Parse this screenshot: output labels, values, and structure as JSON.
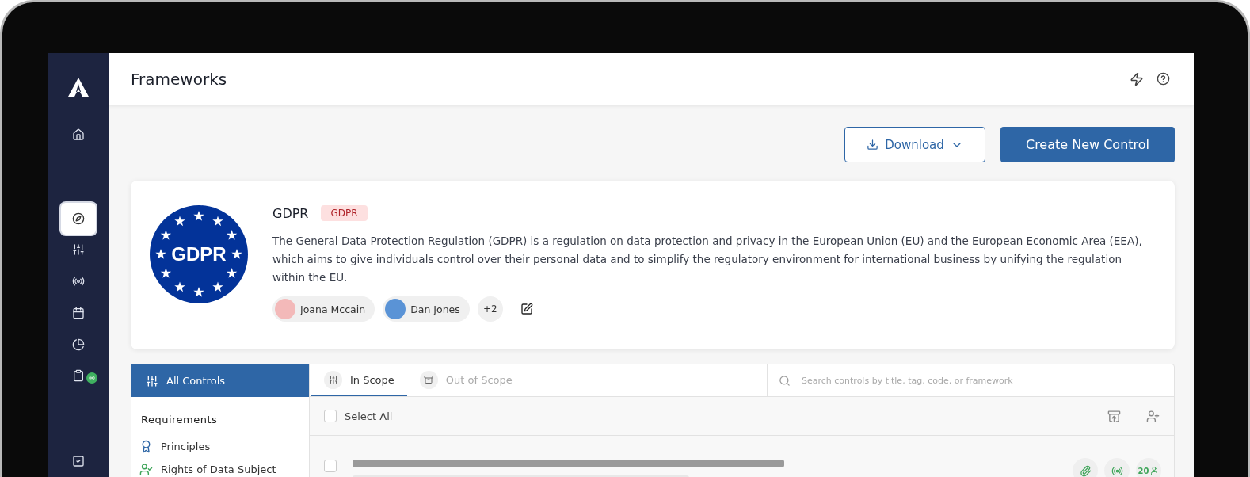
{
  "sidebar": {
    "items": [
      {
        "kind": "home",
        "selected": false,
        "badge": false
      },
      {
        "kind": "compass",
        "selected": true,
        "badge": false
      },
      {
        "kind": "sliders",
        "selected": false,
        "badge": false
      },
      {
        "kind": "radio",
        "selected": false,
        "badge": false
      },
      {
        "kind": "calendar",
        "selected": false,
        "badge": false
      },
      {
        "kind": "pie",
        "selected": false,
        "badge": false
      },
      {
        "kind": "clipboard",
        "selected": false,
        "badge": true
      },
      {
        "kind": "checklist",
        "selected": false,
        "badge": false
      }
    ]
  },
  "header": {
    "title": "Frameworks"
  },
  "actions": {
    "download": "Download",
    "create": "Create New Control"
  },
  "framework": {
    "logo_text": "GDPR",
    "name": "GDPR",
    "tag": "GDPR",
    "description": "The General Data Protection Regulation (GDPR) is a regulation on data protection and privacy in the European Union (EU) and the European Economic Area (EEA), which aims to give individuals control over their personal data and to simplify the regulatory environment for international business by unifying the regulation within the EU.",
    "owners": [
      {
        "name": "Joana Mccain"
      },
      {
        "name": "Dan Jones"
      }
    ],
    "more": "+2"
  },
  "filters": {
    "all_controls": {
      "label": "All Controls",
      "selected": true
    },
    "section": "Requirements",
    "items": [
      {
        "kind": "principles",
        "label": "Principles"
      },
      {
        "kind": "rights",
        "label": "Rights of Data Subject"
      }
    ]
  },
  "tabs": [
    {
      "label": "In Scope",
      "kind": "scope",
      "selected": true
    },
    {
      "label": "Out of Scope",
      "kind": "archive",
      "selected": false
    }
  ],
  "search": {
    "placeholder": "Search controls by title, tag, code, or framework"
  },
  "select_all": {
    "label": "Select All",
    "checked": false
  },
  "rows": [
    {
      "checked": false,
      "count": "20"
    }
  ]
}
